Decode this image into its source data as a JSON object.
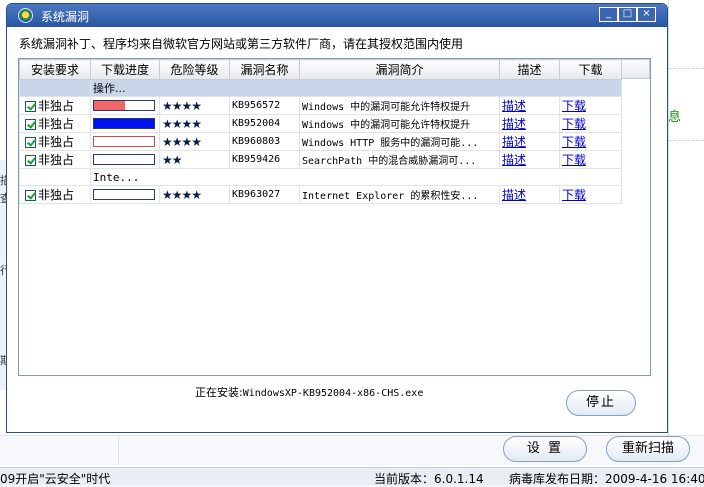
{
  "background": {
    "right_panel_text": "息",
    "collapse_arrow": "◀",
    "left_chars": [
      "描",
      "查",
      "行",
      "期"
    ],
    "buttons": {
      "settings": "设 置",
      "rescan": "重新扫描"
    },
    "statusbar": {
      "left_text": "09开启\"云安全\"时代",
      "version": "当前版本：6.0.1.14",
      "db_date": "病毒库发布日期：2009-4-16 16:40"
    }
  },
  "dialog": {
    "title": "系统漏洞",
    "window_buttons": {
      "minimize": "_",
      "maximize": "□",
      "close": "×"
    },
    "notice": "系统漏洞补丁、程序均来自微软官方网站或第三方软件厂商，请在其授权范围内使用",
    "table": {
      "columns": [
        "安装要求",
        "下载进度",
        "危险等级",
        "漏洞名称",
        "漏洞简介",
        "描述",
        "下载"
      ],
      "group_header": "操作...",
      "rows": [
        {
          "requirement": "非独占",
          "progress": 0.52,
          "progress_color": "#f26666",
          "stars": "★★★★",
          "name": "KB956572",
          "summary": "Windows 中的漏洞可能允许特权提升",
          "desc": "描述",
          "download": "下载"
        },
        {
          "requirement": "非独占",
          "progress": 1.0,
          "progress_color": "#0010ee",
          "stars": "★★★★",
          "name": "KB952004",
          "summary": "Windows 中的漏洞可能允许特权提升",
          "desc": "描述",
          "download": "下载"
        },
        {
          "requirement": "非独占",
          "progress": 0.0,
          "progress_color": "#f26666",
          "stars": "★★★★",
          "name": "KB960803",
          "summary": "Windows HTTP 服务中的漏洞可能...",
          "desc": "描述",
          "download": "下载"
        },
        {
          "requirement": "非独占",
          "progress": 0.0,
          "progress_color": "#0010ee",
          "stars": "★★",
          "name": "KB959426",
          "summary": "SearchPath 中的混合威胁漏洞可...",
          "desc": "描述",
          "download": "下载"
        }
      ],
      "group_header_2": "Inte...",
      "rows_2": [
        {
          "requirement": "非独占",
          "progress": 0.0,
          "progress_color": "#0010ee",
          "stars": "★★★★",
          "name": "KB963027",
          "summary": "Internet Explorer 的累积性安...",
          "desc": "描述",
          "download": "下载"
        }
      ]
    },
    "install_label": "正在安装:",
    "install_file": "WindowsXP-KB952004-x86-CHS.exe",
    "stop_button": "停止"
  }
}
